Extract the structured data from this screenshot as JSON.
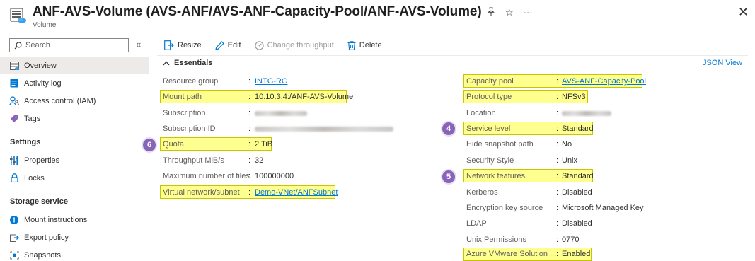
{
  "header": {
    "title": "ANF-AVS-Volume (AVS-ANF/AVS-ANF-Capacity-Pool/ANF-AVS-Volume)",
    "subtitle": "Volume",
    "pin_glyph": "📌",
    "star_glyph": "☆",
    "more_glyph": "···",
    "close_glyph": "✕"
  },
  "sidebar": {
    "search_placeholder": "Search",
    "collapse_glyph": "«",
    "items_top": [
      {
        "label": "Overview",
        "icon": "overview-icon",
        "active": true
      },
      {
        "label": "Activity log",
        "icon": "activity-log-icon"
      },
      {
        "label": "Access control (IAM)",
        "icon": "iam-icon"
      },
      {
        "label": "Tags",
        "icon": "tag-icon"
      }
    ],
    "section_settings": "Settings",
    "items_settings": [
      {
        "label": "Properties",
        "icon": "properties-icon"
      },
      {
        "label": "Locks",
        "icon": "lock-icon"
      }
    ],
    "section_storage": "Storage service",
    "items_storage": [
      {
        "label": "Mount instructions",
        "icon": "info-icon"
      },
      {
        "label": "Export policy",
        "icon": "export-policy-icon"
      },
      {
        "label": "Snapshots",
        "icon": "snapshot-icon"
      }
    ]
  },
  "toolbar": {
    "resize_label": "Resize",
    "edit_label": "Edit",
    "change_throughput_label": "Change throughput",
    "delete_label": "Delete"
  },
  "essentials": {
    "header": "Essentials",
    "json_view": "JSON View",
    "left": [
      {
        "label": "Resource group",
        "value": "INTG-RG",
        "link": true
      },
      {
        "label": "Mount path",
        "value": "10.10.3.4:/ANF-AVS-Volume",
        "highlight": true
      },
      {
        "label": "Subscription",
        "value": "",
        "blurred": true
      },
      {
        "label": "Subscription ID",
        "value": "",
        "blurred": true
      },
      {
        "label": "Quota",
        "value": "2 TiB",
        "highlight": true,
        "badge": "6"
      },
      {
        "label": "Throughput MiB/s",
        "value": "32"
      },
      {
        "label": "Maximum number of files",
        "value": "100000000"
      },
      {
        "label": "Virtual network/subnet",
        "value": "Demo-VNet/ANFSubnet",
        "link": true,
        "highlight": true
      }
    ],
    "right": [
      {
        "label": "Capacity pool",
        "value": "AVS-ANF-Capacity-Pool",
        "link": true,
        "highlight": true
      },
      {
        "label": "Protocol type",
        "value": "NFSv3",
        "highlight": true
      },
      {
        "label": "Location",
        "value": "",
        "blurred": true
      },
      {
        "label": "Service level",
        "value": "Standard",
        "highlight": true,
        "badge": "4"
      },
      {
        "label": "Hide snapshot path",
        "value": "No"
      },
      {
        "label": "Security Style",
        "value": "Unix"
      },
      {
        "label": "Network features",
        "value": "Standard",
        "highlight": true,
        "badge": "5"
      },
      {
        "label": "Kerberos",
        "value": "Disabled"
      },
      {
        "label": "Encryption key source",
        "value": "Microsoft Managed Key"
      },
      {
        "label": "LDAP",
        "value": "Disabled"
      },
      {
        "label": "Unix Permissions",
        "value": "0770"
      },
      {
        "label": "Azure VMware Solution ...",
        "value": "Enabled",
        "highlight": true
      }
    ]
  },
  "colors": {
    "accent": "#0078d4",
    "highlight": "#ffff33",
    "badge": "#8764b8"
  }
}
